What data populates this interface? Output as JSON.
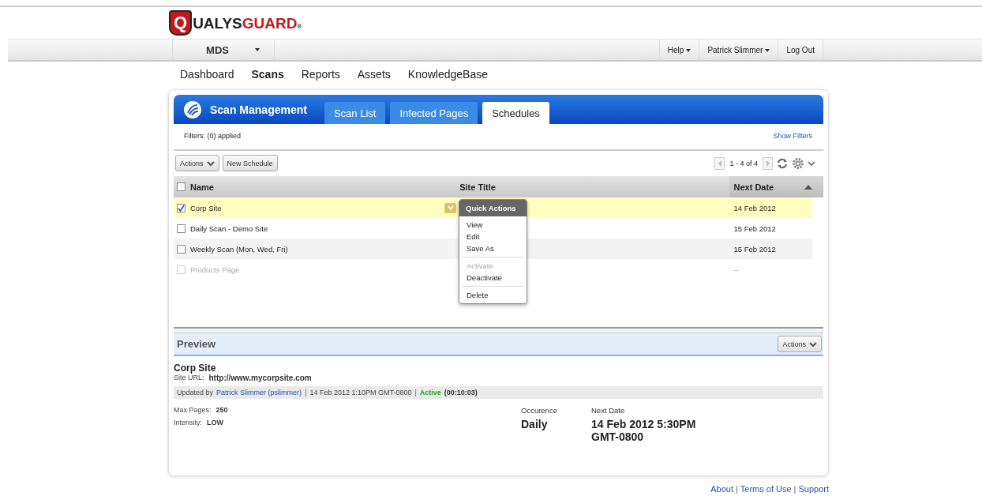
{
  "logo": {
    "initial": "Q",
    "first": "UALYS",
    "second": "GUARD",
    "mark": "®"
  },
  "top_bar": {
    "workspace": "MDS",
    "links": [
      "Help",
      "Patrick Slimmer",
      "Log Out"
    ]
  },
  "nav": [
    {
      "label": "Dashboard",
      "selected": false
    },
    {
      "label": "Scans",
      "selected": true
    },
    {
      "label": "Reports",
      "selected": false
    },
    {
      "label": "Assets",
      "selected": false
    },
    {
      "label": "KnowledgeBase",
      "selected": false
    }
  ],
  "panel": {
    "title": "Scan Management",
    "tabs": [
      {
        "label": "Scan List",
        "selected": false
      },
      {
        "label": "Infected Pages",
        "selected": false
      },
      {
        "label": "Schedules",
        "selected": true
      }
    ]
  },
  "filters": {
    "text": "Filters: (0) applied",
    "link": "Show Filters"
  },
  "toolbar": {
    "actions": "Actions",
    "new": "New Schedule",
    "paging": "1 - 4 of 4"
  },
  "table": {
    "select_all_checked": false,
    "columns": [
      "Name",
      "Site Title",
      "Next Date"
    ],
    "rows": [
      {
        "name": "Corp Site",
        "next_date": "14 Feb 2012",
        "checked": true,
        "selected": true,
        "disabled": false
      },
      {
        "name": "Daily Scan - Demo Site",
        "next_date": "15 Feb 2012",
        "checked": false,
        "selected": false,
        "disabled": false
      },
      {
        "name": "Weekly Scan (Mon, Wed, Fri)",
        "next_date": "15 Feb 2012",
        "checked": false,
        "selected": false,
        "disabled": false
      },
      {
        "name": "Products Page",
        "next_date": "–",
        "checked": false,
        "selected": false,
        "disabled": true
      }
    ]
  },
  "quick_actions": {
    "title": "Quick Actions",
    "items": [
      {
        "label": "View",
        "disabled": false,
        "separator_before": false
      },
      {
        "label": "Edit",
        "disabled": false,
        "separator_before": false
      },
      {
        "label": "Save As",
        "disabled": false,
        "separator_before": false
      },
      {
        "label": "Activate",
        "disabled": true,
        "separator_before": true
      },
      {
        "label": "Deactivate",
        "disabled": false,
        "separator_before": false
      },
      {
        "label": "Delete",
        "disabled": false,
        "separator_before": true
      }
    ]
  },
  "preview": {
    "title": "Preview",
    "actions": "Actions",
    "name": "Corp Site",
    "url_label": "Site URL:",
    "url": "http://www.mycorpsite.com",
    "updated_prefix": "Updated by",
    "updated_user": "Patrick Slimmer (pslimmer)",
    "updated_time": "14 Feb 2012 1:10PM GMT-0800",
    "separators": [
      "|",
      "|"
    ],
    "status": "Active",
    "duration": "(00:10:03)",
    "fields": [
      {
        "label": "Max Pages:",
        "value": "250"
      },
      {
        "label": "Intensity:",
        "value": "LOW"
      }
    ],
    "occurrence_label": "Occurence",
    "occurrence": "Daily",
    "next_label": "Next Date",
    "next_date": "14 Feb 2012 5:30PM GMT-0800"
  },
  "footer": [
    {
      "kind": "link",
      "text": "About"
    },
    {
      "kind": "separator",
      "text": "|"
    },
    {
      "kind": "link",
      "text": "Terms of Use"
    },
    {
      "kind": "separator",
      "text": "|"
    },
    {
      "kind": "link",
      "text": "Support"
    }
  ]
}
